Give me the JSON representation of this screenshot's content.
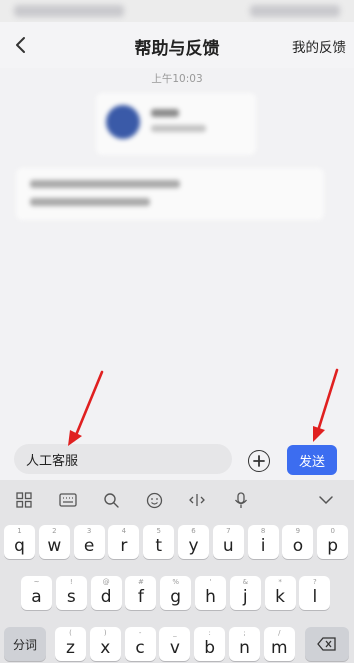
{
  "nav": {
    "title": "帮助与反馈",
    "right_label": "我的反馈"
  },
  "chat": {
    "timestamp": "上午10:03"
  },
  "composer": {
    "input_value": "人工客服",
    "send_label": "发送"
  },
  "keyboard": {
    "row1": [
      {
        "hint": "1",
        "ch": "q"
      },
      {
        "hint": "2",
        "ch": "w"
      },
      {
        "hint": "3",
        "ch": "e"
      },
      {
        "hint": "4",
        "ch": "r"
      },
      {
        "hint": "5",
        "ch": "t"
      },
      {
        "hint": "6",
        "ch": "y"
      },
      {
        "hint": "7",
        "ch": "u"
      },
      {
        "hint": "8",
        "ch": "i"
      },
      {
        "hint": "9",
        "ch": "o"
      },
      {
        "hint": "0",
        "ch": "p"
      }
    ],
    "row2": [
      {
        "hint": "~",
        "ch": "a"
      },
      {
        "hint": "!",
        "ch": "s"
      },
      {
        "hint": "@",
        "ch": "d"
      },
      {
        "hint": "#",
        "ch": "f"
      },
      {
        "hint": "%",
        "ch": "g"
      },
      {
        "hint": "'",
        "ch": "h"
      },
      {
        "hint": "&",
        "ch": "j"
      },
      {
        "hint": "*",
        "ch": "k"
      },
      {
        "hint": "?",
        "ch": "l"
      }
    ],
    "row3": [
      {
        "hint": "(",
        "ch": "z"
      },
      {
        "hint": ")",
        "ch": "x"
      },
      {
        "hint": "-",
        "ch": "c"
      },
      {
        "hint": "_",
        "ch": "v"
      },
      {
        "hint": ":",
        "ch": "b"
      },
      {
        "hint": ";",
        "ch": "n"
      },
      {
        "hint": "/",
        "ch": "m"
      }
    ],
    "fenci_label": "分词"
  },
  "colors": {
    "accent": "#3c6df0",
    "arrow": "#e02020"
  }
}
